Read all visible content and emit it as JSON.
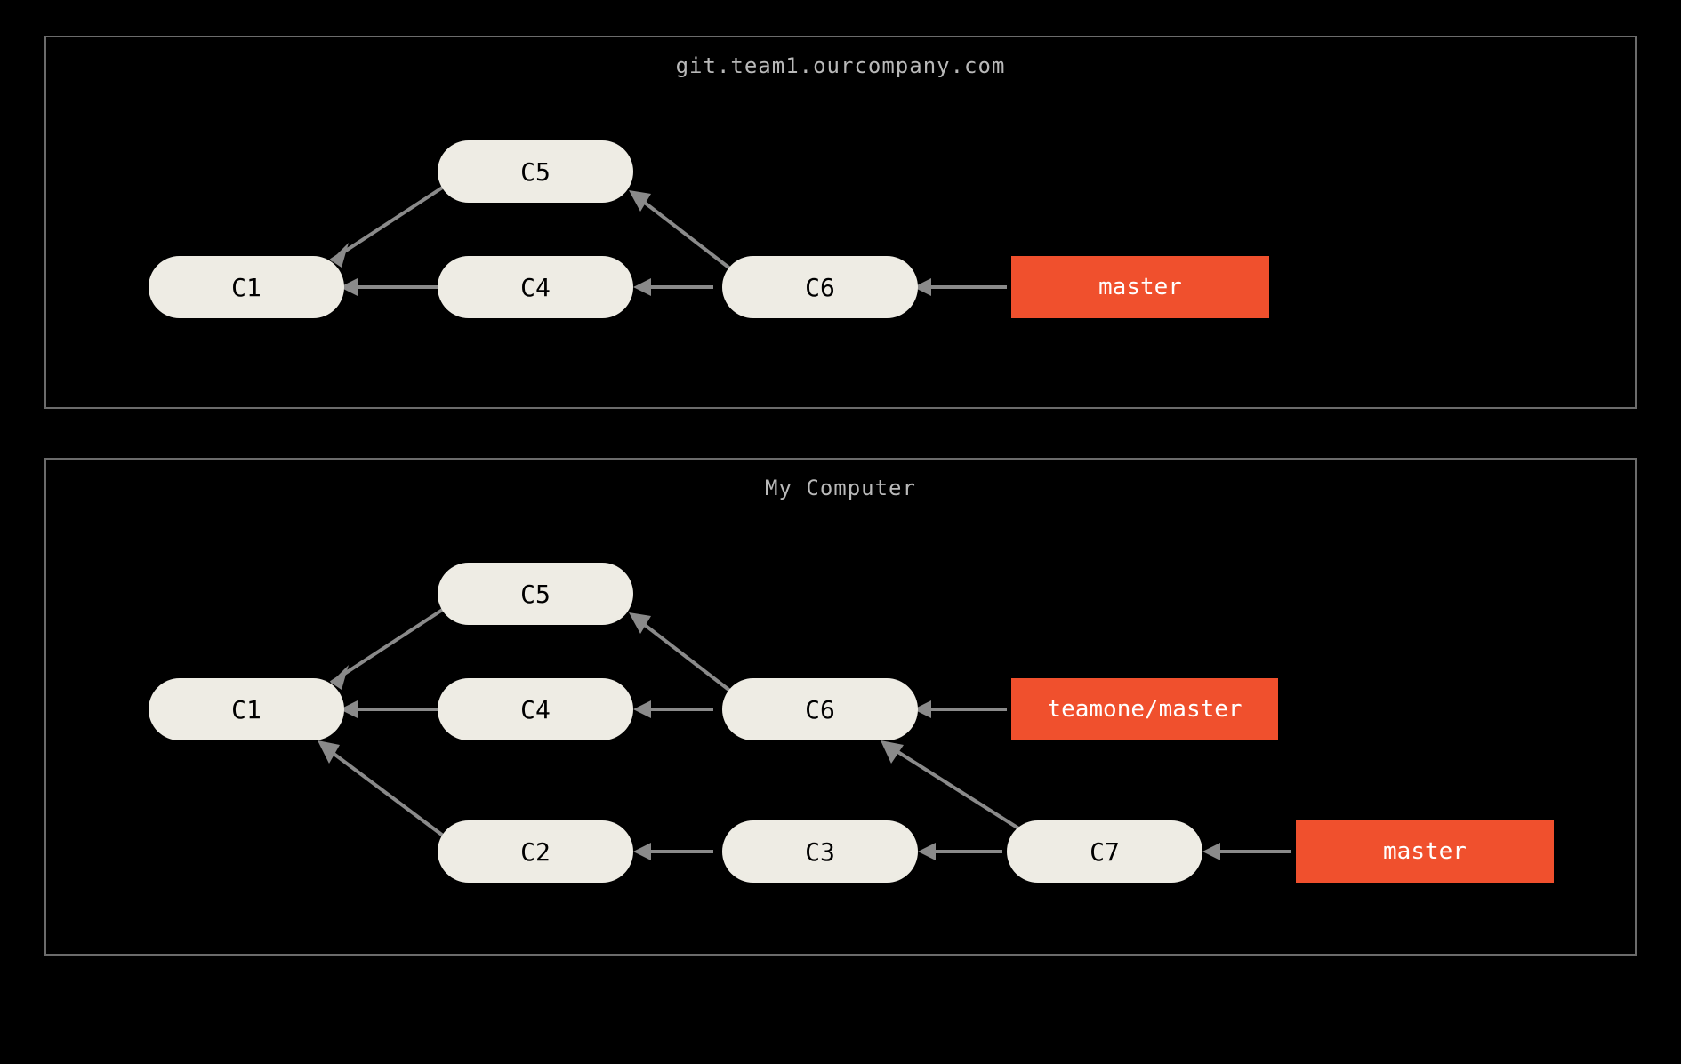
{
  "colors": {
    "bg": "#000000",
    "panel_border": "#6b6b6b",
    "title_text": "#b9b9b9",
    "commit_bg": "#eeece4",
    "commit_text": "#000000",
    "branch_bg": "#f0502d",
    "branch_text": "#ffffff",
    "arrow": "#8a8a8a"
  },
  "panels": {
    "remote": {
      "title": "git.team1.ourcompany.com",
      "commits": {
        "C1": "C1",
        "C4": "C4",
        "C5": "C5",
        "C6": "C6"
      },
      "branches": {
        "master": "master"
      },
      "edges": [
        [
          "C5",
          "C1"
        ],
        [
          "C4",
          "C1"
        ],
        [
          "C6",
          "C5"
        ],
        [
          "C6",
          "C4"
        ],
        [
          "master",
          "C6"
        ]
      ]
    },
    "local": {
      "title": "My Computer",
      "commits": {
        "C1": "C1",
        "C2": "C2",
        "C3": "C3",
        "C4": "C4",
        "C5": "C5",
        "C6": "C6",
        "C7": "C7"
      },
      "branches": {
        "teamone_master": "teamone/master",
        "master": "master"
      },
      "edges": [
        [
          "C5",
          "C1"
        ],
        [
          "C4",
          "C1"
        ],
        [
          "C2",
          "C1"
        ],
        [
          "C6",
          "C5"
        ],
        [
          "C6",
          "C4"
        ],
        [
          "C3",
          "C2"
        ],
        [
          "C7",
          "C6"
        ],
        [
          "C7",
          "C3"
        ],
        [
          "teamone_master",
          "C6"
        ],
        [
          "master",
          "C7"
        ]
      ]
    }
  }
}
